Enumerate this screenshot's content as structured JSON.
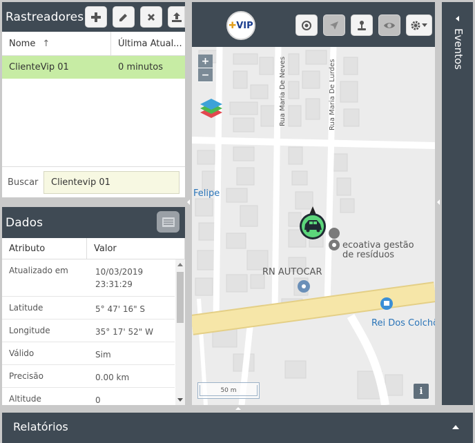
{
  "trackers": {
    "title": "Rastreadores",
    "columns": {
      "name": "Nome",
      "name_sort": "↑",
      "last_update": "Última Atual..."
    },
    "rows": [
      {
        "name": "ClienteVip 01",
        "last_update": "0 minutos"
      }
    ],
    "search": {
      "label": "Buscar",
      "value": "Clientevip 01"
    },
    "toolbar": [
      "add-icon",
      "edit-icon",
      "remove-icon",
      "upload-icon"
    ]
  },
  "dados": {
    "title": "Dados",
    "columns": {
      "attribute": "Atributo",
      "value": "Valor"
    },
    "rows": [
      {
        "attribute": "Atualizado em",
        "value": "10/03/2019 23:31:29"
      },
      {
        "attribute": "Latitude",
        "value": "5° 47' 16\" S"
      },
      {
        "attribute": "Longitude",
        "value": "35° 17' 52\" W"
      },
      {
        "attribute": "Válido",
        "value": "Sim"
      },
      {
        "attribute": "Precisão",
        "value": "0.00 km"
      },
      {
        "attribute": "Altitude",
        "value": "0"
      }
    ]
  },
  "map": {
    "logo_text_main": "VIP",
    "logo_prefix": "✚",
    "zoom_in": "+",
    "zoom_out": "−",
    "streets": [
      "Rua Maria De Neves",
      "Rua Maria De Lurdes"
    ],
    "labels": {
      "felipe": "Felipe",
      "ecoativa_1": "ecoativa gestão",
      "ecoativa_2": "de resíduos",
      "autocar": "RN AUTOCAR",
      "rei": "Rei Dos Colchõ"
    },
    "scale": "50 m",
    "info": "i",
    "colors": {
      "road_major": "#f6e6a8",
      "label_blue": "#2a74b8",
      "marker_green": "#5cd67b",
      "poi_gray": "#757575"
    }
  },
  "eventos": {
    "title": "Eventos"
  },
  "relatorios": {
    "title": "Relatórios"
  },
  "colors": {
    "panel_dark": "#3f4a54",
    "selected_row": "#c7eca4",
    "search_bg": "#f7f8e2"
  }
}
